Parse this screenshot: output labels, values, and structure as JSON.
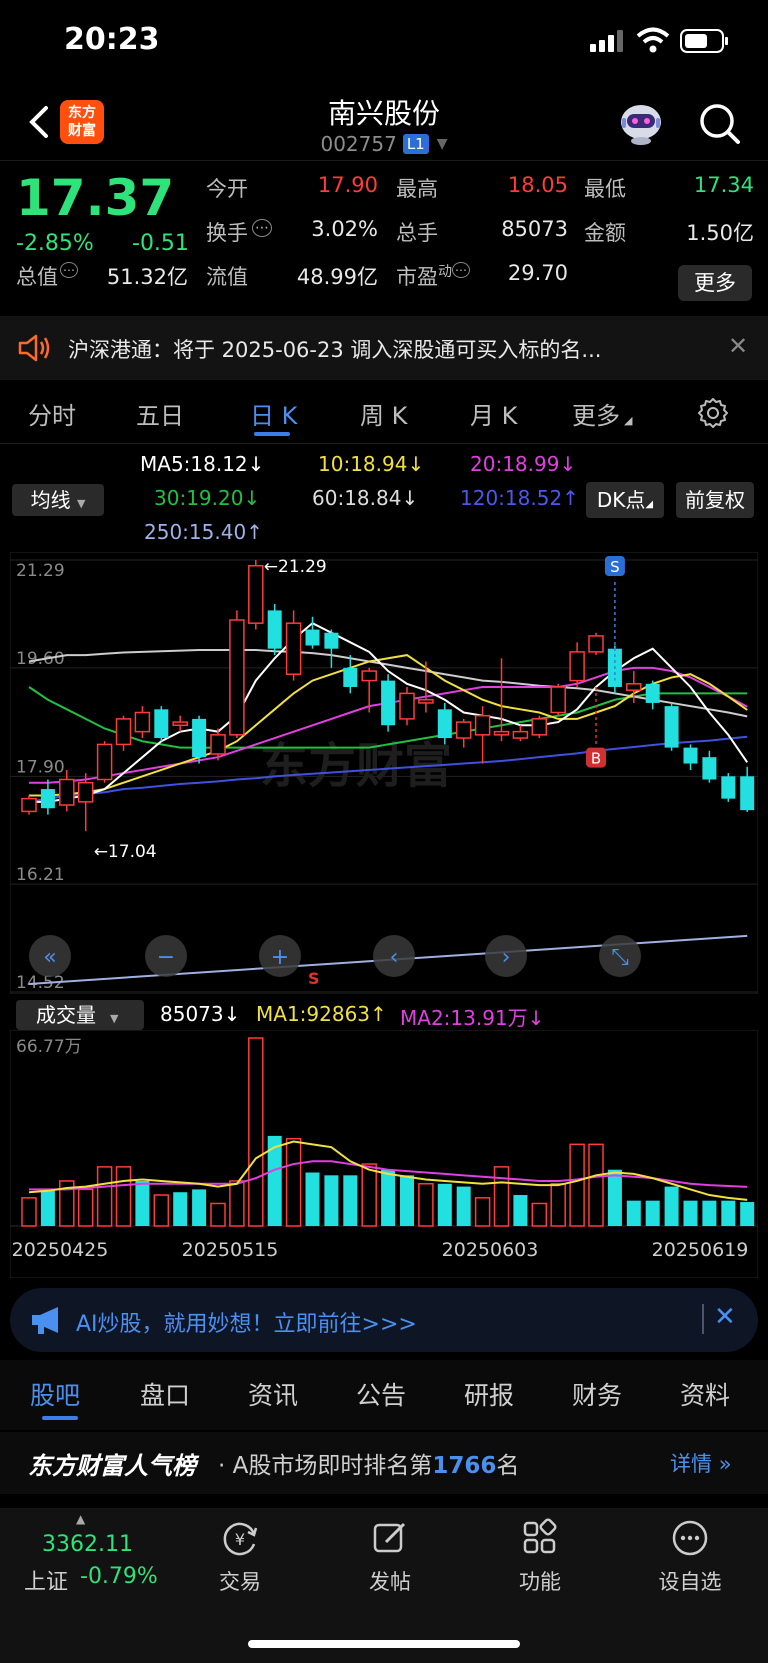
{
  "status": {
    "time": "20:23"
  },
  "header": {
    "logo_text": "东方\n财富",
    "name": "南兴股份",
    "code": "002757",
    "level": "L1"
  },
  "quote": {
    "price": "17.37",
    "change_pct": "-2.85%",
    "change_abs": "-0.51",
    "open_label": "今开",
    "open": "17.90",
    "high_label": "最高",
    "high": "18.05",
    "low_label": "最低",
    "low": "17.34",
    "turnover_label": "换手",
    "turnover": "3.02%",
    "volume_label": "总手",
    "volume": "85073",
    "amount_label": "金额",
    "amount": "1.50亿",
    "mcap_label": "总值",
    "mcap": "51.32亿",
    "float_label": "流值",
    "float": "48.99亿",
    "pe_label": "市盈",
    "pe_sup": "动",
    "pe": "29.70",
    "more": "更多"
  },
  "notice": {
    "text": "沪深港通：将于 2025-06-23 调入深股通可买入标的名..."
  },
  "tabs": [
    "分时",
    "五日",
    "日 K",
    "周 K",
    "月 K",
    "更多"
  ],
  "ma_legend": {
    "selector": "均线",
    "ma5": "MA5:18.12↓",
    "ma10": "10:18.94↓",
    "ma20": "20:18.99↓",
    "ma30": "30:19.20↓",
    "ma60": "60:18.84↓",
    "ma120": "120:18.52↑",
    "ma250": "250:15.40↑",
    "dk": "DK点",
    "fq": "前复权"
  },
  "colors": {
    "up": "#ff3b3b",
    "down": "#22e0e0",
    "ma5": "#ffffff",
    "ma10": "#f0e040",
    "ma20": "#e040e0",
    "ma30": "#20c040",
    "ma60": "#cccccc",
    "ma120": "#4050e0",
    "ma250": "#a0b0e0"
  },
  "chart_data": [
    {
      "type": "candlestick",
      "y_ticks": [
        "21.29",
        "19.60",
        "17.90",
        "16.21",
        "14.52"
      ],
      "ylim": [
        14.52,
        21.29
      ],
      "max_label": "21.29",
      "min_label": "17.04",
      "marker_s": "S",
      "marker_b": "B",
      "watermark": "东方财富",
      "candles": [
        {
          "o": 17.35,
          "c": 17.55,
          "h": 17.6,
          "l": 17.3
        },
        {
          "o": 17.7,
          "c": 17.4,
          "h": 17.85,
          "l": 17.3
        },
        {
          "o": 17.45,
          "c": 17.85,
          "h": 18.0,
          "l": 17.35
        },
        {
          "o": 17.5,
          "c": 17.8,
          "h": 17.95,
          "l": 17.04
        },
        {
          "o": 17.85,
          "c": 18.4,
          "h": 18.45,
          "l": 17.8
        },
        {
          "o": 18.4,
          "c": 18.8,
          "h": 18.85,
          "l": 18.3
        },
        {
          "o": 18.6,
          "c": 18.9,
          "h": 19.0,
          "l": 18.5
        },
        {
          "o": 18.95,
          "c": 18.5,
          "h": 19.0,
          "l": 18.45
        },
        {
          "o": 18.7,
          "c": 18.75,
          "h": 18.85,
          "l": 18.6
        },
        {
          "o": 18.8,
          "c": 18.2,
          "h": 18.85,
          "l": 18.1
        },
        {
          "o": 18.25,
          "c": 18.55,
          "h": 18.65,
          "l": 18.15
        },
        {
          "o": 18.55,
          "c": 20.35,
          "h": 20.5,
          "l": 18.5
        },
        {
          "o": 20.3,
          "c": 21.2,
          "h": 21.29,
          "l": 20.2
        },
        {
          "o": 20.5,
          "c": 19.9,
          "h": 20.6,
          "l": 19.8
        },
        {
          "o": 19.5,
          "c": 20.3,
          "h": 20.5,
          "l": 19.4
        },
        {
          "o": 20.2,
          "c": 19.95,
          "h": 20.4,
          "l": 19.9
        },
        {
          "o": 20.15,
          "c": 19.9,
          "h": 20.2,
          "l": 19.6
        },
        {
          "o": 19.6,
          "c": 19.3,
          "h": 19.8,
          "l": 19.2
        },
        {
          "o": 19.4,
          "c": 19.55,
          "h": 19.6,
          "l": 18.9
        },
        {
          "o": 19.4,
          "c": 18.7,
          "h": 19.5,
          "l": 18.6
        },
        {
          "o": 18.8,
          "c": 19.2,
          "h": 19.3,
          "l": 18.7
        },
        {
          "o": 19.05,
          "c": 19.1,
          "h": 19.7,
          "l": 18.9
        },
        {
          "o": 18.95,
          "c": 18.5,
          "h": 19.05,
          "l": 18.4
        },
        {
          "o": 18.5,
          "c": 18.75,
          "h": 18.8,
          "l": 18.35
        },
        {
          "o": 18.55,
          "c": 18.85,
          "h": 19.0,
          "l": 18.1
        },
        {
          "o": 18.55,
          "c": 18.6,
          "h": 19.75,
          "l": 18.45
        },
        {
          "o": 18.5,
          "c": 18.6,
          "h": 18.7,
          "l": 18.45
        },
        {
          "o": 18.55,
          "c": 18.8,
          "h": 18.85,
          "l": 18.5
        },
        {
          "o": 18.9,
          "c": 19.3,
          "h": 19.35,
          "l": 18.85
        },
        {
          "o": 19.4,
          "c": 19.85,
          "h": 20.0,
          "l": 19.3
        },
        {
          "o": 19.85,
          "c": 20.1,
          "h": 20.15,
          "l": 19.8
        },
        {
          "o": 19.9,
          "c": 19.3,
          "h": 19.95,
          "l": 19.2
        },
        {
          "o": 19.25,
          "c": 19.35,
          "h": 19.55,
          "l": 19.05
        },
        {
          "o": 19.35,
          "c": 19.05,
          "h": 19.4,
          "l": 18.95
        },
        {
          "o": 19.0,
          "c": 18.35,
          "h": 19.05,
          "l": 18.3
        },
        {
          "o": 18.35,
          "c": 18.1,
          "h": 18.4,
          "l": 18.0
        },
        {
          "o": 18.2,
          "c": 17.85,
          "h": 18.3,
          "l": 17.8
        },
        {
          "o": 17.9,
          "c": 17.55,
          "h": 17.95,
          "l": 17.5
        },
        {
          "o": 17.9,
          "c": 17.37,
          "h": 18.05,
          "l": 17.34
        }
      ],
      "ma_series": {
        "ma5": [
          17.5,
          17.5,
          17.55,
          17.6,
          17.7,
          17.95,
          18.2,
          18.45,
          18.6,
          18.65,
          18.6,
          18.85,
          19.4,
          19.75,
          20.05,
          20.3,
          20.15,
          20.0,
          19.85,
          19.55,
          19.35,
          19.25,
          19.1,
          18.9,
          18.85,
          18.8,
          18.7,
          18.7,
          18.75,
          18.95,
          19.3,
          19.55,
          19.75,
          19.9,
          19.6,
          19.3,
          18.9,
          18.55,
          18.12
        ],
        "ma10": [
          17.6,
          17.6,
          17.62,
          17.65,
          17.7,
          17.8,
          17.9,
          18.0,
          18.1,
          18.2,
          18.3,
          18.45,
          18.7,
          18.95,
          19.2,
          19.4,
          19.5,
          19.6,
          19.7,
          19.75,
          19.8,
          19.6,
          19.4,
          19.25,
          19.1,
          19.0,
          18.95,
          18.9,
          18.8,
          18.8,
          18.9,
          19.0,
          19.2,
          19.35,
          19.45,
          19.5,
          19.35,
          19.15,
          18.94
        ],
        "ma20": [
          17.8,
          17.8,
          17.82,
          17.85,
          17.9,
          17.95,
          18.0,
          18.05,
          18.1,
          18.15,
          18.2,
          18.3,
          18.4,
          18.5,
          18.6,
          18.7,
          18.8,
          18.9,
          19.0,
          19.05,
          19.1,
          19.15,
          19.2,
          19.25,
          19.3,
          19.3,
          19.3,
          19.3,
          19.3,
          19.35,
          19.45,
          19.55,
          19.6,
          19.6,
          19.55,
          19.45,
          19.3,
          19.15,
          18.99
        ],
        "ma30": [
          19.3,
          19.1,
          18.95,
          18.8,
          18.65,
          18.55,
          18.45,
          18.4,
          18.35,
          18.35,
          18.35,
          18.35,
          18.35,
          18.35,
          18.35,
          18.35,
          18.35,
          18.35,
          18.35,
          18.4,
          18.45,
          18.5,
          18.55,
          18.6,
          18.65,
          18.7,
          18.75,
          18.8,
          18.85,
          18.9,
          19.0,
          19.1,
          19.15,
          19.2,
          19.2,
          19.2,
          19.2,
          19.2,
          19.2
        ],
        "ma60": [
          19.7,
          19.75,
          19.8,
          19.8,
          19.82,
          19.84,
          19.85,
          19.86,
          19.87,
          19.88,
          19.88,
          19.88,
          19.88,
          19.86,
          19.85,
          19.83,
          19.8,
          19.75,
          19.7,
          19.65,
          19.6,
          19.55,
          19.5,
          19.45,
          19.4,
          19.38,
          19.35,
          19.32,
          19.3,
          19.28,
          19.25,
          19.2,
          19.15,
          19.1,
          19.05,
          19.0,
          18.95,
          18.9,
          18.84
        ],
        "ma120": [
          17.5,
          17.55,
          17.6,
          17.62,
          17.65,
          17.7,
          17.72,
          17.75,
          17.78,
          17.8,
          17.82,
          17.85,
          17.87,
          17.9,
          17.92,
          17.94,
          17.96,
          17.98,
          18.0,
          18.02,
          18.04,
          18.06,
          18.08,
          18.1,
          18.12,
          18.14,
          18.17,
          18.2,
          18.23,
          18.26,
          18.3,
          18.33,
          18.36,
          18.39,
          18.42,
          18.44,
          18.46,
          18.49,
          18.52
        ]
      },
      "ma250_line": [
        14.52,
        15.4
      ]
    },
    {
      "type": "bar",
      "title": "成交量",
      "ylabel_top": "66.77万",
      "ymax": 667700,
      "x_labels": [
        "20250425",
        "20250515",
        "20250603",
        "20250619"
      ],
      "legend": {
        "value": "85073↓",
        "ma1": "MA1:92863↑",
        "ma2": "MA2:13.91万↓"
      },
      "volumes": [
        {
          "v": 100000,
          "up": 1
        },
        {
          "v": 130000,
          "up": 0
        },
        {
          "v": 160000,
          "up": 1
        },
        {
          "v": 130000,
          "up": 1
        },
        {
          "v": 210000,
          "up": 1
        },
        {
          "v": 210000,
          "up": 1
        },
        {
          "v": 160000,
          "up": 0
        },
        {
          "v": 110000,
          "up": 1
        },
        {
          "v": 120000,
          "up": 0
        },
        {
          "v": 130000,
          "up": 0
        },
        {
          "v": 80000,
          "up": 1
        },
        {
          "v": 160000,
          "up": 1
        },
        {
          "v": 667700,
          "up": 1
        },
        {
          "v": 320000,
          "up": 0
        },
        {
          "v": 310000,
          "up": 1
        },
        {
          "v": 190000,
          "up": 0
        },
        {
          "v": 180000,
          "up": 0
        },
        {
          "v": 180000,
          "up": 0
        },
        {
          "v": 220000,
          "up": 1
        },
        {
          "v": 200000,
          "up": 0
        },
        {
          "v": 180000,
          "up": 0
        },
        {
          "v": 150000,
          "up": 1
        },
        {
          "v": 150000,
          "up": 0
        },
        {
          "v": 140000,
          "up": 0
        },
        {
          "v": 100000,
          "up": 1
        },
        {
          "v": 210000,
          "up": 1
        },
        {
          "v": 110000,
          "up": 0
        },
        {
          "v": 80000,
          "up": 1
        },
        {
          "v": 150000,
          "up": 1
        },
        {
          "v": 290000,
          "up": 1
        },
        {
          "v": 290000,
          "up": 1
        },
        {
          "v": 200000,
          "up": 0
        },
        {
          "v": 90000,
          "up": 0
        },
        {
          "v": 90000,
          "up": 0
        },
        {
          "v": 140000,
          "up": 0
        },
        {
          "v": 90000,
          "up": 0
        },
        {
          "v": 90000,
          "up": 0
        },
        {
          "v": 90000,
          "up": 0
        },
        {
          "v": 85073,
          "up": 0
        }
      ],
      "ma1": [
        120000,
        125000,
        135000,
        140000,
        150000,
        160000,
        165000,
        160000,
        155000,
        150000,
        140000,
        150000,
        240000,
        280000,
        300000,
        290000,
        280000,
        230000,
        200000,
        185000,
        175000,
        165000,
        160000,
        155000,
        150000,
        155000,
        150000,
        145000,
        145000,
        160000,
        180000,
        190000,
        185000,
        170000,
        150000,
        130000,
        110000,
        100000,
        92863
      ],
      "ma2": [
        130000,
        130000,
        130000,
        135000,
        140000,
        145000,
        150000,
        150000,
        150000,
        150000,
        150000,
        150000,
        170000,
        200000,
        220000,
        230000,
        230000,
        220000,
        210000,
        200000,
        195000,
        190000,
        185000,
        180000,
        175000,
        170000,
        165000,
        160000,
        160000,
        165000,
        175000,
        180000,
        175000,
        170000,
        160000,
        150000,
        145000,
        142000,
        139100
      ]
    }
  ],
  "chart_controls": [
    "«",
    "−",
    "+",
    "‹",
    "›",
    "⤡"
  ],
  "ai_banner": {
    "text": "AI炒股，就用妙想！立即前往>>>"
  },
  "info_tabs": [
    "股吧",
    "盘口",
    "资讯",
    "公告",
    "研报",
    "财务",
    "资料"
  ],
  "rank": {
    "title": "东方财富人气榜",
    "text_prefix": "· A股市场即时排名第",
    "number": "1766",
    "text_suffix": "名",
    "detail": "详情"
  },
  "bottom_nav": {
    "index_price": "3362.11",
    "index_name": "上证",
    "index_change": "-0.79%",
    "items": [
      "交易",
      "发帖",
      "功能",
      "设自选"
    ]
  }
}
